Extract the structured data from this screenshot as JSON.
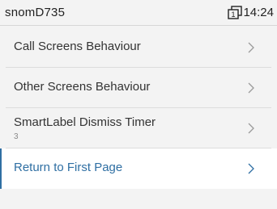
{
  "status_bar": {
    "device_name": "snomD735",
    "line_number": "1",
    "time": "14:24"
  },
  "menu": {
    "items": [
      {
        "label": "Call Screens Behaviour"
      },
      {
        "label": "Other Screens Behaviour"
      },
      {
        "label": "SmartLabel Dismiss Timer",
        "value": "3"
      },
      {
        "label": "Return to First Page",
        "selected": true
      }
    ]
  },
  "colors": {
    "accent": "#2f6fa3",
    "background": "#f3f3f3",
    "selected_background": "#ffffff"
  },
  "icons": {
    "line": "line-key-icon",
    "chevron": "chevron-right-icon"
  }
}
